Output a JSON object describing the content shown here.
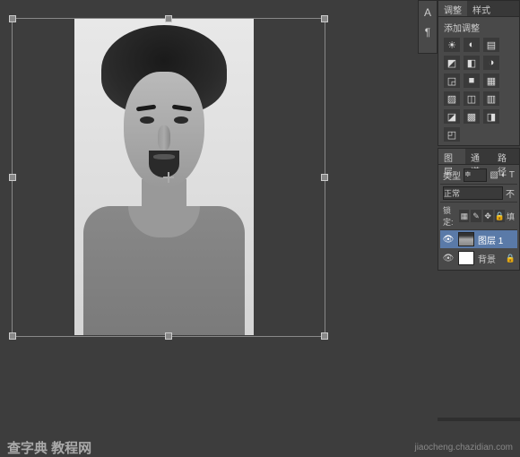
{
  "canvas": {
    "transform_active": true
  },
  "tool_strip": {
    "text_icon": "A",
    "para_icon": "¶"
  },
  "adjustments_panel": {
    "tabs": [
      "调整",
      "样式"
    ],
    "active_tab": 0,
    "label": "添加调整",
    "icons": [
      "☀",
      "◐",
      "▤",
      "◩",
      "◧",
      "◑",
      "◲",
      "■",
      "▦",
      "▨",
      "◫",
      "▥",
      "◪",
      "▩",
      "◨",
      "◰"
    ]
  },
  "layers_panel": {
    "tabs": [
      "图层",
      "通道",
      "路径"
    ],
    "active_tab": 0,
    "kind_label": "类型",
    "blend_mode": "正常",
    "opacity_label": "不",
    "lock_label": "锁定:",
    "fill_label": "填",
    "layers": [
      {
        "name": "图层 1",
        "visible": true,
        "selected": true,
        "thumb": "portrait"
      },
      {
        "name": "背景",
        "visible": true,
        "selected": false,
        "thumb": "white",
        "locked": true
      }
    ]
  },
  "watermark": {
    "brand": "查字典 教程网",
    "url": "jiaocheng.chazidian.com"
  }
}
